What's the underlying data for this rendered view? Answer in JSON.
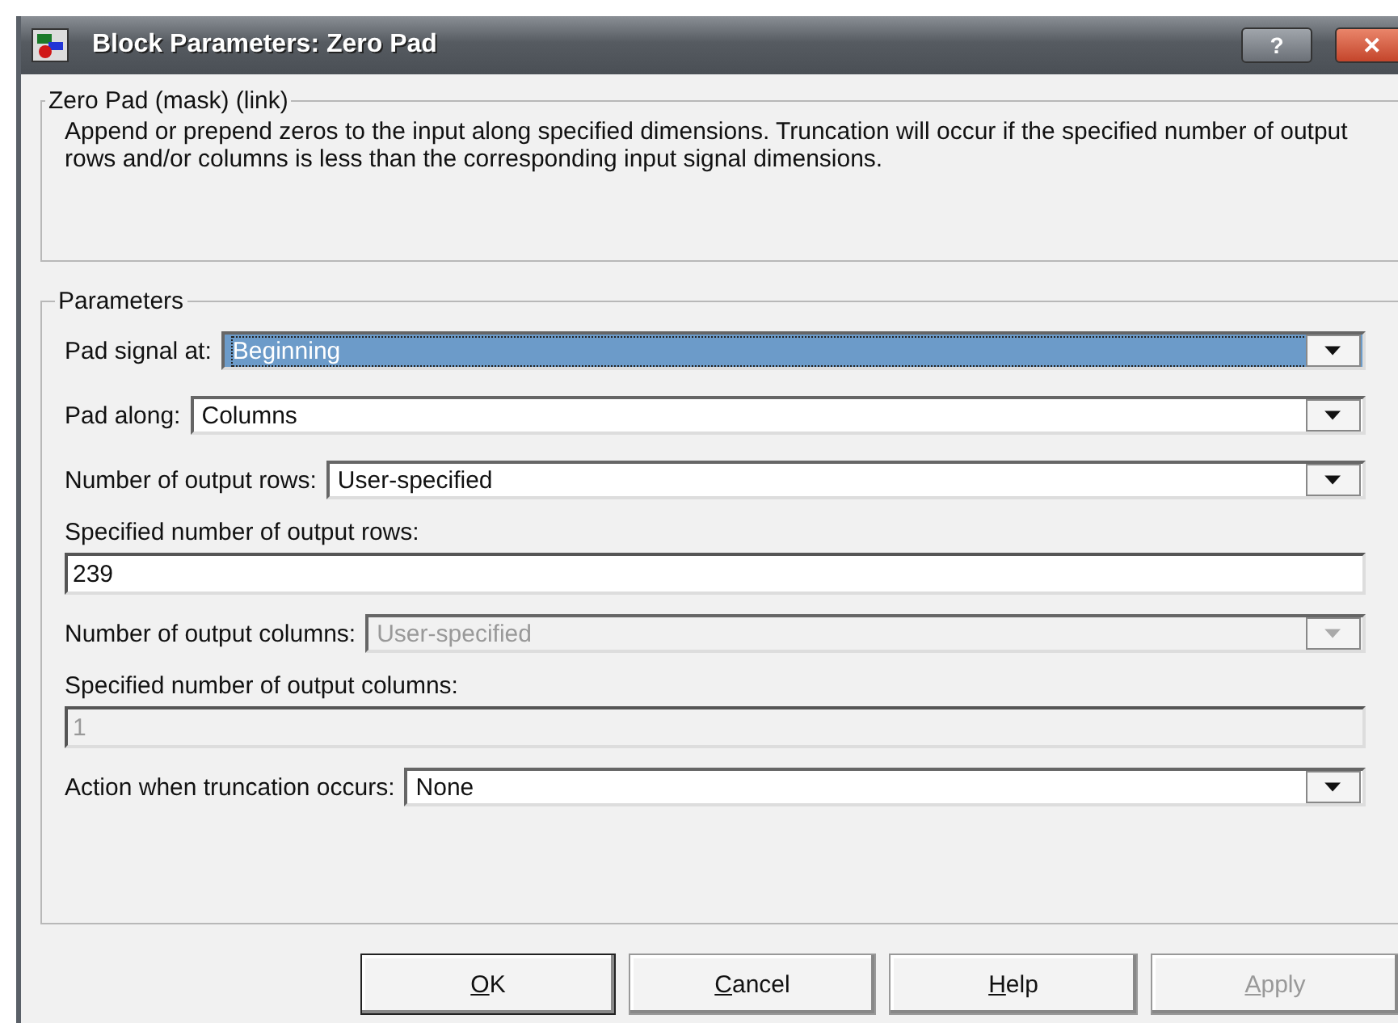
{
  "window": {
    "title": "Block Parameters: Zero Pad",
    "help_button": "?",
    "close_button": "✕"
  },
  "description_group": {
    "title": "Zero Pad (mask) (link)",
    "text": "Append or prepend zeros to the input along specified dimensions.  Truncation will occur if the specified number of output rows and/or columns is less than the corresponding input signal dimensions."
  },
  "parameters_group": {
    "title": "Parameters",
    "fields": [
      {
        "kind": "dropdown",
        "label": "Pad signal at:",
        "value": "Beginning",
        "disabled": false,
        "focused": true
      },
      {
        "kind": "dropdown",
        "label": "Pad along:",
        "value": "Columns",
        "disabled": false,
        "focused": false
      },
      {
        "kind": "dropdown",
        "label": "Number of output rows:",
        "value": "User-specified",
        "disabled": false,
        "focused": false
      },
      {
        "kind": "text",
        "label": "Specified number of output rows:",
        "value": "239",
        "disabled": false
      },
      {
        "kind": "dropdown",
        "label": "Number of output columns:",
        "value": "User-specified",
        "disabled": true,
        "focused": false
      },
      {
        "kind": "text",
        "label": "Specified number of output columns:",
        "value": "1",
        "disabled": true
      },
      {
        "kind": "dropdown",
        "label": "Action when truncation occurs:",
        "value": "None",
        "disabled": false,
        "focused": false
      }
    ]
  },
  "buttons": [
    {
      "label": "OK",
      "disabled": false,
      "default": true
    },
    {
      "label": "Cancel",
      "disabled": false,
      "default": false
    },
    {
      "label": "Help",
      "disabled": false,
      "default": false
    },
    {
      "label": "Apply",
      "disabled": true,
      "default": false
    }
  ]
}
